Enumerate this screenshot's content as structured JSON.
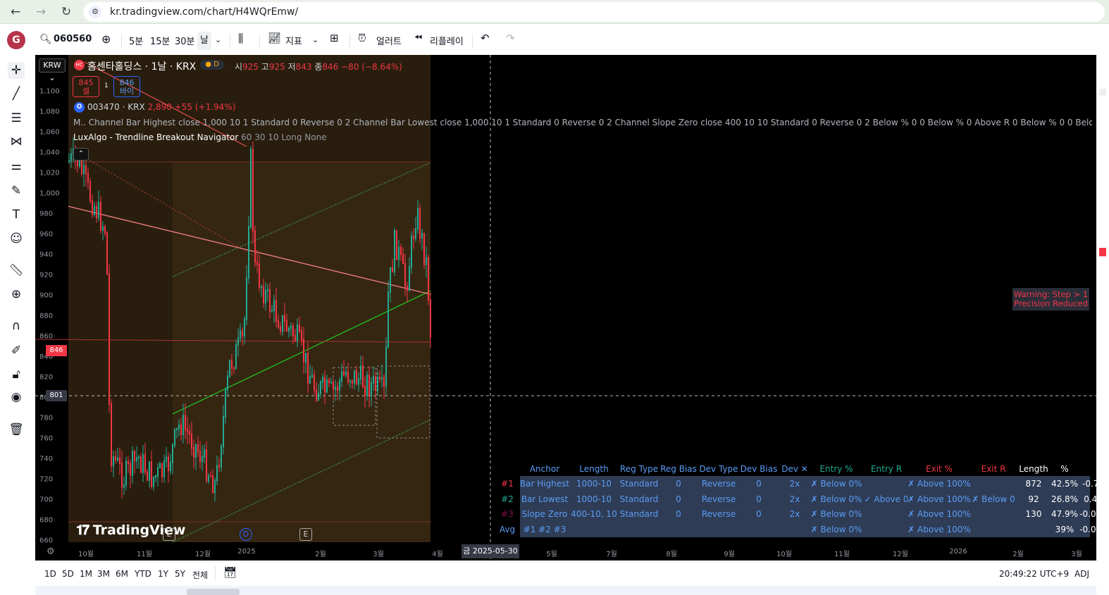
{
  "browser": {
    "url": "kr.tradingview.com/chart/H4WQrEmw/"
  },
  "topbar": {
    "avatar": "G",
    "symbol": "060560",
    "intervals": [
      "5분",
      "15분",
      "30분",
      "날"
    ],
    "indicators": "지표",
    "alerts": "얼러트",
    "replay": "리플레이"
  },
  "chart": {
    "currency": "KRW",
    "title": "홈센타홀딩스 · 1날 · KRX",
    "badge": "D",
    "ohlc": {
      "o_label": "시",
      "o": "925",
      "h_label": "고",
      "h": "925",
      "l_label": "저",
      "l": "843",
      "c_label": "종",
      "c": "846",
      "change": "−80 (−8.64%)"
    },
    "sell": {
      "price": "845",
      "label": "셀"
    },
    "spread": "1",
    "buy": {
      "price": "846",
      "label": "바이"
    },
    "compare": {
      "symbol": "003470 · KRX",
      "price": "2,890",
      "change": "+55 (+1.94%)"
    },
    "indicator_line": "M.. Channel Bar Highest close 1,000 10 1 Standard 0 Reverse 0 2 Channel Bar Lowest close 1,000 10 1 Standard 0 Reverse 0 2 Channel Slope Zero close 400 10 10 Standard 0 Reverse 0 2 Below % 0 0 Below % 0 Above R 0 Below % 0 0 Below % 0 0 Above % 100 0 Above % 100 Belo...",
    "luxalgo": {
      "name": "LuxAlgo - Trendline Breakout Navigator",
      "params": "60 30 10 Long None"
    },
    "y_labels": [
      "1,100",
      "1,080",
      "1,060",
      "1,040",
      "1,020",
      "1,000",
      "980",
      "960",
      "940",
      "920",
      "900",
      "880",
      "860",
      "840",
      "820",
      "800",
      "780",
      "760",
      "740",
      "720",
      "700",
      "680",
      "660"
    ],
    "x_labels": [
      "10월",
      "11월",
      "12월",
      "2025",
      "2월",
      "3월",
      "4월",
      "5월",
      "7월",
      "8월",
      "9월",
      "10월",
      "11월",
      "12월",
      "2026",
      "2월",
      "3월",
      "4월"
    ],
    "price_tag": "846",
    "cursor_tag": "801",
    "cursor_date": "금 2025-05-30",
    "warning": [
      "Warning: Step > 1",
      "Precision Reduced"
    ],
    "watermark": "TradingView",
    "events": [
      "E",
      "D",
      "E"
    ],
    "table": {
      "headers": [
        {
          "t": "Anchor",
          "c": "#5b9cf6"
        },
        {
          "t": "Length",
          "c": "#5b9cf6"
        },
        {
          "t": "Reg Type",
          "c": "#5b9cf6"
        },
        {
          "t": "Reg Bias",
          "c": "#5b9cf6"
        },
        {
          "t": "Dev Type",
          "c": "#5b9cf6"
        },
        {
          "t": "Dev Bias",
          "c": "#5b9cf6"
        },
        {
          "t": "Dev ✕",
          "c": "#5b9cf6"
        },
        {
          "t": "Entry %",
          "c": "#22ab94"
        },
        {
          "t": "Entry R",
          "c": "#22ab94"
        },
        {
          "t": "Exit %",
          "c": "#f23645"
        },
        {
          "t": "Exit R",
          "c": "#f23645"
        },
        {
          "t": "Length",
          "c": "#ffffff"
        },
        {
          "t": "%",
          "c": "#ffffff"
        },
        {
          "t": "R",
          "c": "#ffffff"
        }
      ],
      "rows": [
        {
          "id": "#1",
          "anchor": "Bar Highest",
          "length": "1000-10",
          "reg_type": "Standard",
          "reg_bias": "0",
          "dev_type": "Reverse",
          "dev_bias": "0",
          "dev_x": "2x",
          "entry_pct": "✗ Below 0%",
          "entry_r": "",
          "exit_pct": "✗ Above 100%",
          "exit_r": "",
          "len": "872",
          "pct": "42.5%",
          "r": "-0.72752"
        },
        {
          "id": "#2",
          "anchor": "Bar Lowest",
          "length": "1000-10",
          "reg_type": "Standard",
          "reg_bias": "0",
          "dev_type": "Reverse",
          "dev_bias": "0",
          "dev_x": "2x",
          "entry_pct": "✗ Below 0%",
          "entry_r": "✓ Above 0",
          "exit_pct": "✗ Above 100%",
          "exit_r": "✗ Below 0",
          "len": "92",
          "pct": "26.8%",
          "r": "0.46160"
        },
        {
          "id": "#3",
          "anchor": "Slope Zero",
          "length": "400-10, 10",
          "reg_type": "Standard",
          "reg_bias": "0",
          "dev_type": "Reverse",
          "dev_bias": "0",
          "dev_x": "2x",
          "entry_pct": "✗ Below 0%",
          "entry_r": "",
          "exit_pct": "✗ Above 100%",
          "exit_r": "",
          "len": "130",
          "pct": "47.9%",
          "r": "-0.013441"
        },
        {
          "id": "Avg",
          "anchor": "#1 #2 #3",
          "length": "",
          "reg_type": "",
          "reg_bias": "",
          "dev_type": "",
          "dev_bias": "",
          "dev_x": "",
          "entry_pct": "✗ Below 0%",
          "entry_r": "",
          "exit_pct": "✗ Above 100%",
          "exit_r": "",
          "len": "",
          "pct": "39%",
          "r": "-0.093120"
        }
      ],
      "row_id_colors": [
        "#f23645",
        "#22ab94",
        "#880e4f",
        "#5b9cf6"
      ]
    }
  },
  "bottombar": {
    "ranges": [
      "1D",
      "5D",
      "1M",
      "3M",
      "6M",
      "YTD",
      "1Y",
      "5Y",
      "전체"
    ],
    "time": "20:49:22 UTC+9",
    "adj": "ADJ"
  }
}
